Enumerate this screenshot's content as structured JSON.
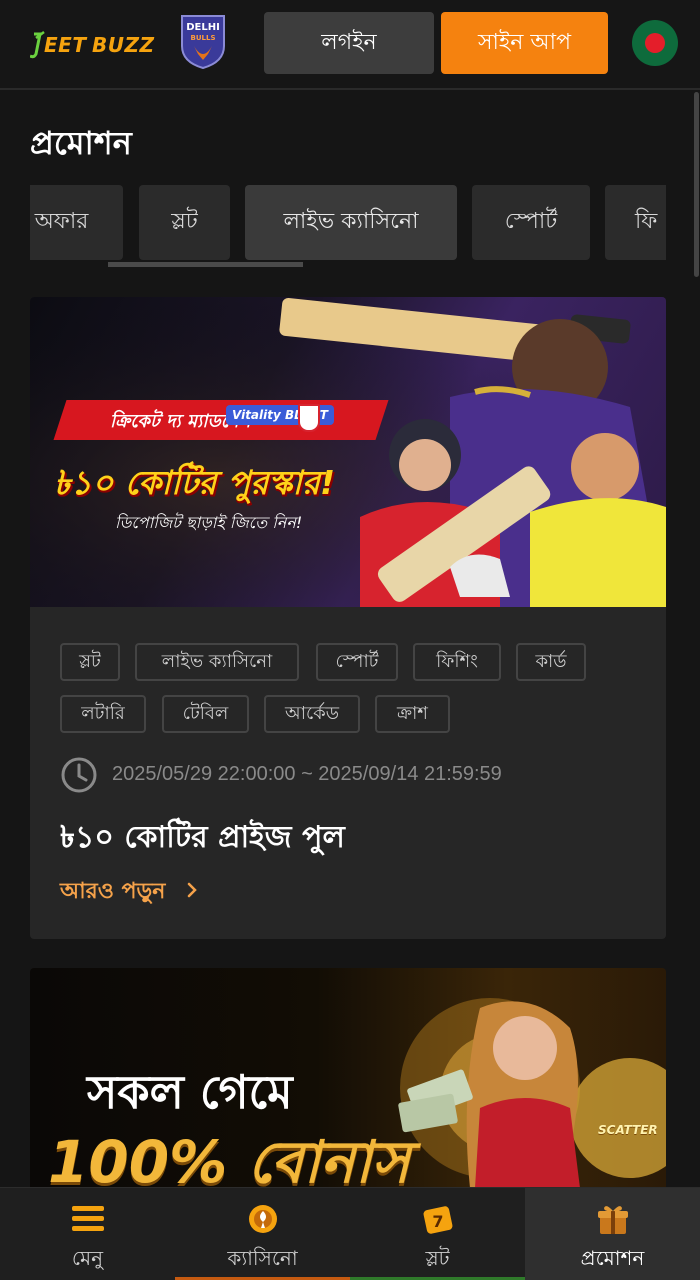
{
  "header": {
    "logo": "JeetBuzz",
    "partner_badge": "DELHI BULLS",
    "login_label": "লগইন",
    "signup_label": "সাইন আপ"
  },
  "page_title": "প্রমোশন",
  "tabs": [
    {
      "label": "অফার"
    },
    {
      "label": "স্লট"
    },
    {
      "label": "লাইভ ক্যাসিনো"
    },
    {
      "label": "স্পোর্ট"
    },
    {
      "label": "ফি"
    }
  ],
  "promo": {
    "banner": {
      "ribbon": "ক্রিকেট দ্য ম্যাডনেস",
      "ribbon_brand": "Vitality BLAST",
      "headline": "৳১০ কোটির পুরস্কার!",
      "subline": "ডিপোজিট ছাড়াই জিতে নিন!"
    },
    "categories": [
      "স্লট",
      "লাইভ ক্যাসিনো",
      "স্পোর্ট",
      "ফিশিং",
      "কার্ড",
      "লটারি",
      "টেবিল",
      "আর্কেড",
      "ক্রাশ"
    ],
    "date_range": "2025/05/29 22:00:00 ~ 2025/09/14 21:59:59",
    "title": "৳১০ কোটির প্রাইজ পুল",
    "read_more": "আরও পড়ুন"
  },
  "promo2": {
    "line1": "সকল গেমে",
    "line2": "100% বোনাস",
    "scatter_label": "SCATTER"
  },
  "bottom_nav": [
    {
      "label": "মেনু",
      "icon": "menu-icon"
    },
    {
      "label": "ক্যাসিনো",
      "icon": "casino-icon"
    },
    {
      "label": "স্লট",
      "icon": "slot-icon"
    },
    {
      "label": "প্রমোশন",
      "icon": "gift-icon"
    }
  ],
  "colors": {
    "accent": "#f5820f",
    "brand_green": "#6bd13f",
    "background": "#151515"
  }
}
